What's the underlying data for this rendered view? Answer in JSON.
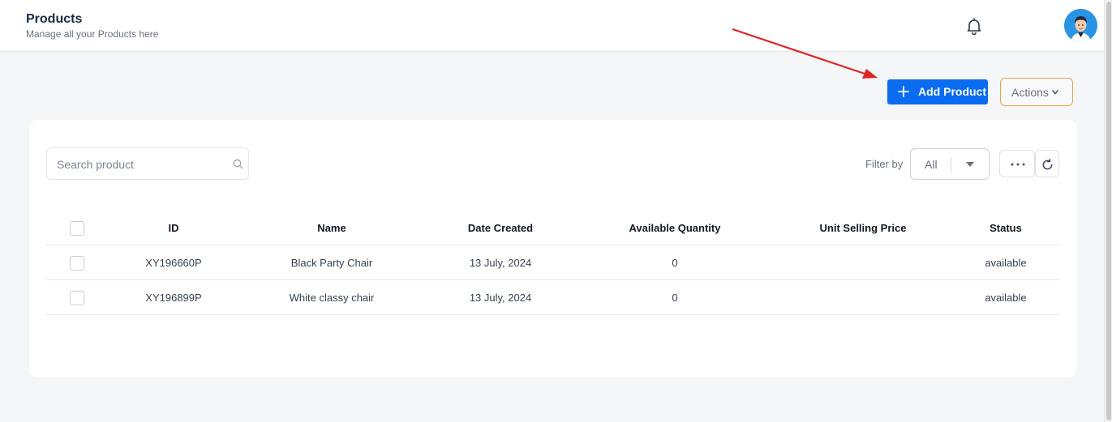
{
  "header": {
    "title": "Products",
    "subtitle": "Manage all your Products here"
  },
  "toolbar": {
    "add_label": "Add Product",
    "actions_label": "Actions"
  },
  "search": {
    "placeholder": "Search product",
    "value": ""
  },
  "filter": {
    "label": "Filter by",
    "selected": "All"
  },
  "table": {
    "columns": [
      "ID",
      "Name",
      "Date Created",
      "Available Quantity",
      "Unit Selling Price",
      "Status"
    ],
    "rows": [
      {
        "id": "XY196660P",
        "name": "Black Party Chair",
        "date": "13 July, 2024",
        "quantity": "0",
        "price": "",
        "status": "available"
      },
      {
        "id": "XY196899P",
        "name": "White classy chair",
        "date": "13 July, 2024",
        "quantity": "0",
        "price": "",
        "status": "available"
      }
    ]
  },
  "colors": {
    "primary": "#0a6cf0",
    "actions_border": "#e8a24c",
    "annotation_arrow": "#e02424",
    "avatar_bg": "#2a94e4"
  },
  "icons": {
    "bell": "bell-icon",
    "avatar": "user-avatar",
    "add": "plus-icon",
    "actions": "chevron-down-icon",
    "search": "search-icon",
    "filter": "caret-down-icon",
    "more": "more-horizontal-icon",
    "refresh": "refresh-icon"
  }
}
